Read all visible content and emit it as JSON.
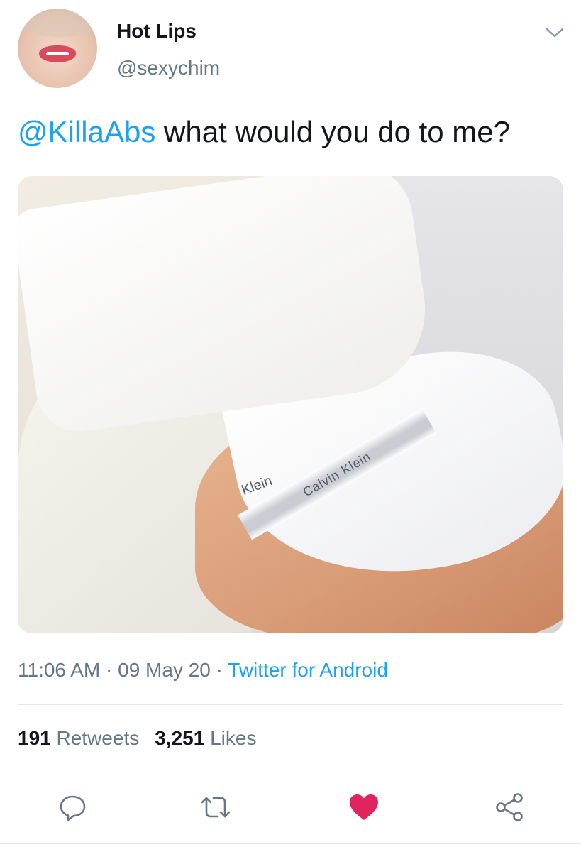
{
  "author": {
    "display_name": "Hot Lips",
    "handle": "@sexychim"
  },
  "tweet": {
    "mention": "@KillaAbs",
    "text": " what would you do to me?",
    "media": {
      "brand_text_band": "Calvin Klein",
      "brand_text_band_lower": "Klein"
    }
  },
  "meta": {
    "time": "11:06 AM",
    "sep1": " · ",
    "date": "09 May 20",
    "sep2": " · ",
    "source": "Twitter for Android"
  },
  "stats": {
    "retweets_count": "191",
    "retweets_label": "Retweets",
    "likes_count": "3,251",
    "likes_label": "Likes"
  },
  "colors": {
    "link": "#1da1f2",
    "secondary_text": "#657786",
    "like_active": "#e0245e"
  },
  "icons": {
    "menu": "chevron-down-icon",
    "reply": "reply-icon",
    "retweet": "retweet-icon",
    "like": "heart-icon",
    "share": "share-icon"
  }
}
